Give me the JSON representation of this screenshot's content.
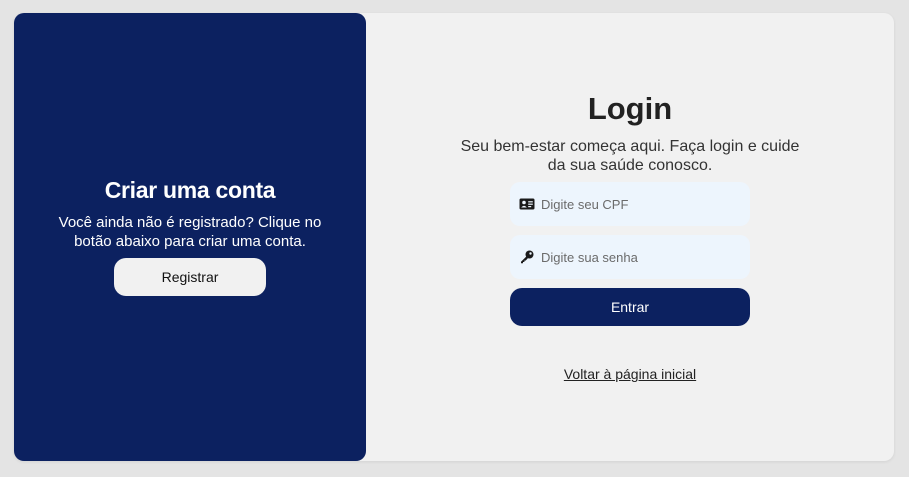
{
  "register_panel": {
    "title": "Criar uma conta",
    "description": "Você ainda não é registrado? Clique no botão abaixo para criar uma conta.",
    "register_button": "Registrar"
  },
  "login_panel": {
    "title": "Login",
    "subtitle": "Seu bem-estar começa aqui. Faça login e cuide da sua saúde conosco.",
    "cpf_field": {
      "placeholder": "Digite seu CPF",
      "value": "",
      "icon": "id-card-icon"
    },
    "password_field": {
      "placeholder": "Digite sua senha",
      "value": "",
      "icon": "key-icon"
    },
    "enter_button": "Entrar",
    "back_link": "Voltar à página inicial"
  },
  "colors": {
    "primary": "#0c2160",
    "background": "#e4e4e4",
    "card": "#f1f1f1",
    "input_bg": "#edf5fd"
  }
}
